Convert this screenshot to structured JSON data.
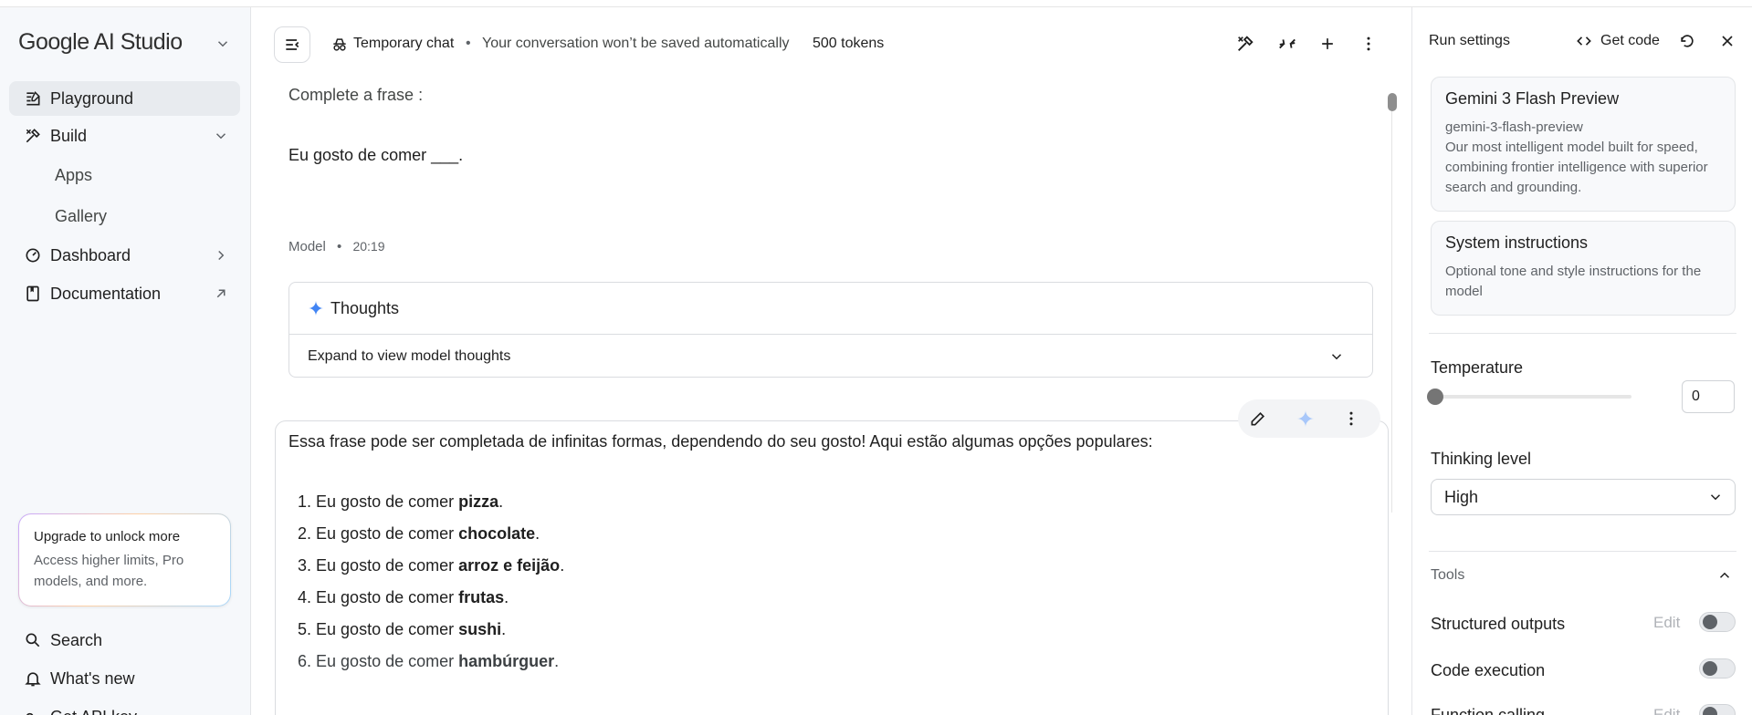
{
  "sidebar": {
    "brand": "Google AI Studio",
    "nav": [
      {
        "label": "Playground"
      },
      {
        "label": "Build"
      },
      {
        "label": "Dashboard"
      },
      {
        "label": "Documentation"
      }
    ],
    "build_sub": [
      "Apps",
      "Gallery"
    ],
    "upgrade": {
      "title": "Upgrade to unlock more",
      "text": "Access higher limits, Pro models, and more."
    },
    "bottom": [
      {
        "label": "Search"
      },
      {
        "label": "What's new"
      },
      {
        "label": "Get API key"
      }
    ]
  },
  "toolbar": {
    "chat_type": "Temporary chat",
    "chat_note": "Your conversation won’t be saved automatically",
    "tokens": "500 tokens"
  },
  "chat": {
    "user_line1": "Complete a frase :",
    "user_line2": "Eu gosto de comer ___.",
    "model_label": "Model",
    "model_time": "20:19",
    "thoughts_title": "Thoughts",
    "thoughts_expand": "Expand to view model thoughts",
    "response_intro": "Essa frase pode ser completada de infinitas formas, dependendo do seu gosto! Aqui estão algumas opções populares:",
    "list_prefix": "Eu gosto de comer",
    "items": [
      {
        "num": "1.",
        "word": "pizza"
      },
      {
        "num": "2.",
        "word": "chocolate"
      },
      {
        "num": "3.",
        "word": "arroz e feijão"
      },
      {
        "num": "4.",
        "word": "frutas"
      },
      {
        "num": "5.",
        "word": "sushi"
      },
      {
        "num": "6.",
        "word": "hambúrguer"
      }
    ]
  },
  "run_settings": {
    "title": "Run settings",
    "get_code": "Get code",
    "model_card": {
      "name": "Gemini 3 Flash Preview",
      "id": "gemini-3-flash-preview",
      "desc": "Our most intelligent model built for speed, combining frontier intelligence with superior search and grounding."
    },
    "system_card": {
      "title": "System instructions",
      "desc": "Optional tone and style instructions for the model"
    },
    "temperature_label": "Temperature",
    "temperature_value": "0",
    "temperature_fraction": 0,
    "thinking_label": "Thinking level",
    "thinking_value": "High",
    "tools_label": "Tools",
    "tools": [
      {
        "label": "Structured outputs",
        "edit": "Edit"
      },
      {
        "label": "Code execution"
      },
      {
        "label": "Function calling",
        "edit": "Edit"
      }
    ]
  },
  "colors": {
    "accent": "#4285f4",
    "active_nav": "#e8ebef"
  }
}
